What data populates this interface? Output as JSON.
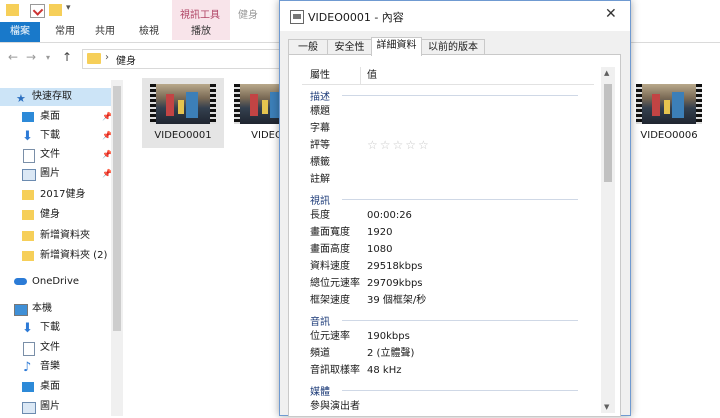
{
  "ribbon": {
    "context_tab": "視訊工具",
    "tabs": [
      "檔案",
      "常用",
      "共用",
      "檢視",
      "播放"
    ],
    "title_faded": "健身"
  },
  "address": {
    "breadcrumb": "健身"
  },
  "nav": {
    "quick_access": "快速存取",
    "items": [
      {
        "label": "桌面",
        "icon": "desktop-icon",
        "pinned": true
      },
      {
        "label": "下載",
        "icon": "download-icon",
        "pinned": true
      },
      {
        "label": "文件",
        "icon": "document-icon",
        "pinned": true
      },
      {
        "label": "圖片",
        "icon": "picture-icon",
        "pinned": true
      },
      {
        "label": "2017健身",
        "icon": "folder-icon",
        "pinned": false
      },
      {
        "label": "健身",
        "icon": "folder-icon",
        "pinned": false
      },
      {
        "label": "新增資料夾",
        "icon": "folder-icon",
        "pinned": false
      },
      {
        "label": "新增資料夾 (2)",
        "icon": "folder-icon",
        "pinned": false
      }
    ],
    "onedrive": "OneDrive",
    "this_pc": "本機",
    "pc_items": [
      {
        "label": "下載",
        "icon": "download-icon"
      },
      {
        "label": "文件",
        "icon": "document-icon"
      },
      {
        "label": "音樂",
        "icon": "music-icon"
      },
      {
        "label": "桌面",
        "icon": "desktop-icon"
      },
      {
        "label": "圖片",
        "icon": "picture-icon"
      }
    ]
  },
  "files": [
    {
      "name": "VIDEO0001",
      "selected": true
    },
    {
      "name": "VIDEO",
      "selected": false
    },
    {
      "name": "VIDEO0006",
      "selected": false
    }
  ],
  "dialog": {
    "title": "VIDEO0001 - 內容",
    "tabs": [
      "一般",
      "安全性",
      "詳細資料",
      "以前的版本"
    ],
    "active_tab": "詳細資料",
    "col_property": "屬性",
    "col_value": "值",
    "sections": [
      {
        "heading": "描述",
        "rows": [
          {
            "name": "標題",
            "value": ""
          },
          {
            "name": "字幕",
            "value": ""
          },
          {
            "name": "評等",
            "value": "☆☆☆☆☆"
          },
          {
            "name": "標籤",
            "value": ""
          },
          {
            "name": "註解",
            "value": ""
          }
        ]
      },
      {
        "heading": "視訊",
        "rows": [
          {
            "name": "長度",
            "value": "00:00:26"
          },
          {
            "name": "畫面寬度",
            "value": "1920"
          },
          {
            "name": "畫面高度",
            "value": "1080"
          },
          {
            "name": "資料速度",
            "value": "29518kbps"
          },
          {
            "name": "總位元速率",
            "value": "29709kbps"
          },
          {
            "name": "框架速度",
            "value": "39 個框架/秒"
          }
        ]
      },
      {
        "heading": "音訊",
        "rows": [
          {
            "name": "位元速率",
            "value": "190kbps"
          },
          {
            "name": "頻道",
            "value": "2 (立體聲)"
          },
          {
            "name": "音訊取樣率",
            "value": "48 kHz"
          }
        ]
      },
      {
        "heading": "媒體",
        "rows": [
          {
            "name": "參與演出者",
            "value": ""
          }
        ]
      }
    ]
  },
  "colors": {
    "file_tab": "#1979ca",
    "context_tab_bg": "#f8e4ea",
    "context_tab_text": "#b04565",
    "selection": "#cce4f7",
    "section_heading": "#1f3d7a",
    "folder": "#f6cf59"
  }
}
